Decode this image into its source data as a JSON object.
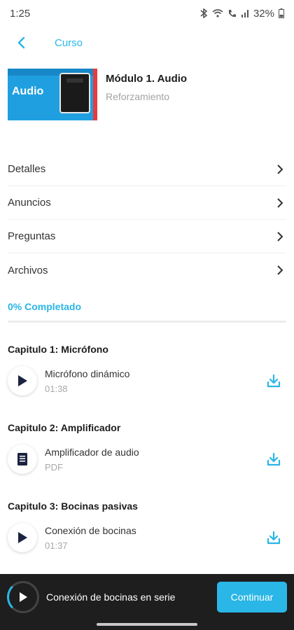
{
  "status": {
    "time": "1:25",
    "battery": "32%"
  },
  "header": {
    "title": "Curso"
  },
  "course": {
    "thumb_label": "Audio",
    "title": "Módulo 1. Audio",
    "subtitle": "Reforzamiento"
  },
  "menu": [
    {
      "label": "Detalles"
    },
    {
      "label": "Anuncios"
    },
    {
      "label": "Preguntas"
    },
    {
      "label": "Archivos"
    }
  ],
  "progress": {
    "label": "0% Completado",
    "fraction": 0.0
  },
  "chapters": [
    {
      "title": "Capitulo 1: Micrófono",
      "lesson": {
        "name": "Micrófono dinámico",
        "meta": "01:38",
        "icon": "play-icon"
      }
    },
    {
      "title": "Capitulo 2: Amplificador",
      "lesson": {
        "name": "Amplificador de audio",
        "meta": "PDF",
        "icon": "document-icon"
      }
    },
    {
      "title": "Capitulo 3: Bocinas pasivas",
      "lesson": {
        "name": "Conexión de bocinas",
        "meta": "01:37",
        "icon": "play-icon"
      }
    }
  ],
  "player": {
    "title": "Conexión de bocinas en serie",
    "button": "Continuar"
  },
  "colors": {
    "accent": "#2ab6e6",
    "player_bg": "#1e1e1e",
    "navy": "#1b2340"
  }
}
